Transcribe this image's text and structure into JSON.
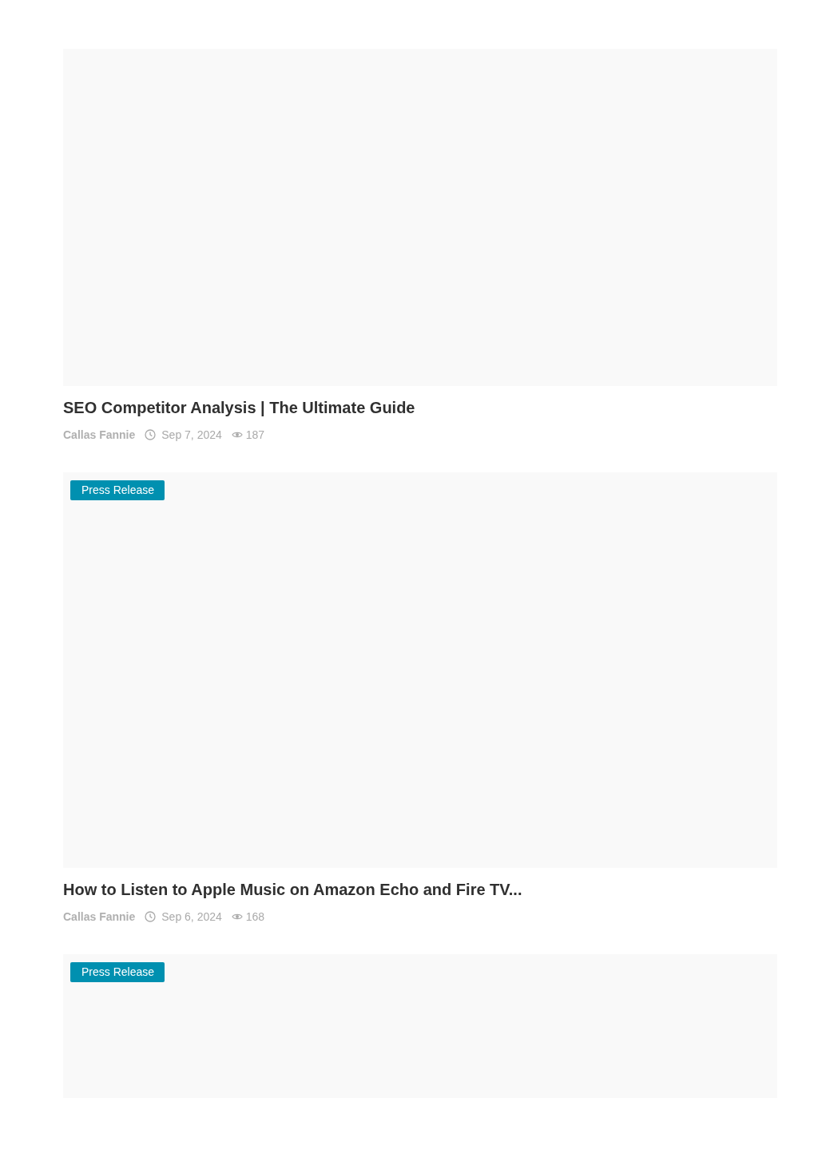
{
  "posts": [
    {
      "title": "SEO Competitor Analysis | The Ultimate Guide",
      "author": "Callas Fannie",
      "date": "Sep 7, 2024",
      "views": "187"
    },
    {
      "category": "Press Release",
      "title": "How to Listen to Apple Music on Amazon Echo and Fire TV...",
      "author": "Callas Fannie",
      "date": "Sep 6, 2024",
      "views": "168"
    },
    {
      "category": "Press Release"
    }
  ]
}
